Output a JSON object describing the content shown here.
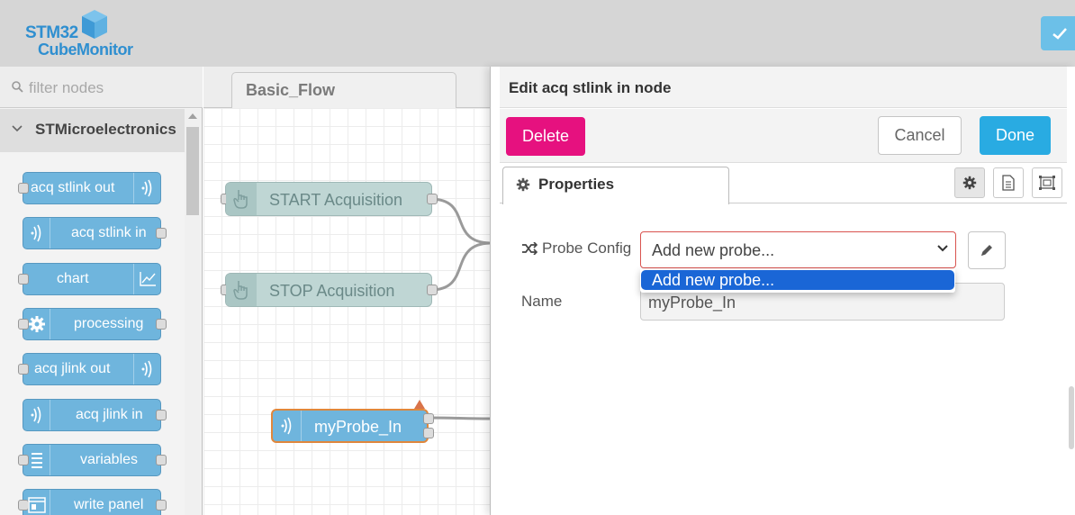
{
  "app": {
    "logo_line1": "STM32",
    "logo_line2": "CubeMonitor"
  },
  "palette": {
    "filter_placeholder": "filter nodes",
    "category": "STMicroelectronics",
    "nodes": [
      {
        "label": "acq stlink out",
        "icon": "wave-icon"
      },
      {
        "label": "acq stlink in",
        "icon": "wave-icon"
      },
      {
        "label": "chart",
        "icon": "line-chart-icon"
      },
      {
        "label": "processing",
        "icon": "gear-icon"
      },
      {
        "label": "acq jlink out",
        "icon": "wave-icon"
      },
      {
        "label": "acq jlink in",
        "icon": "wave-icon"
      },
      {
        "label": "variables",
        "icon": "list-icon"
      },
      {
        "label": "write panel",
        "icon": "panel-icon"
      }
    ]
  },
  "workspace": {
    "tab_label": "Basic_Flow",
    "nodes": [
      {
        "label": "START Acquisition",
        "icon": "hand-pointer-icon"
      },
      {
        "label": "STOP Acquisition",
        "icon": "hand-pointer-icon"
      },
      {
        "label": "myProbe_In",
        "icon": "wave-icon"
      }
    ]
  },
  "editor": {
    "title": "Edit acq stlink in node",
    "delete_label": "Delete",
    "cancel_label": "Cancel",
    "done_label": "Done",
    "properties_tab": "Properties",
    "probe_config_label": "Probe Config",
    "probe_config_value": "Add new probe...",
    "dropdown_options": [
      "Add new probe..."
    ],
    "name_label": "Name",
    "name_value": "myProbe_In"
  },
  "colors": {
    "accent_blue": "#29abe2",
    "delete_pink": "#e6117f",
    "node_blue": "#6fb5dd",
    "inject_teal": "#bfd6d4",
    "error_red": "#d9534f",
    "selection_orange": "#e0873c",
    "dropdown_highlight": "#1a66d6"
  }
}
